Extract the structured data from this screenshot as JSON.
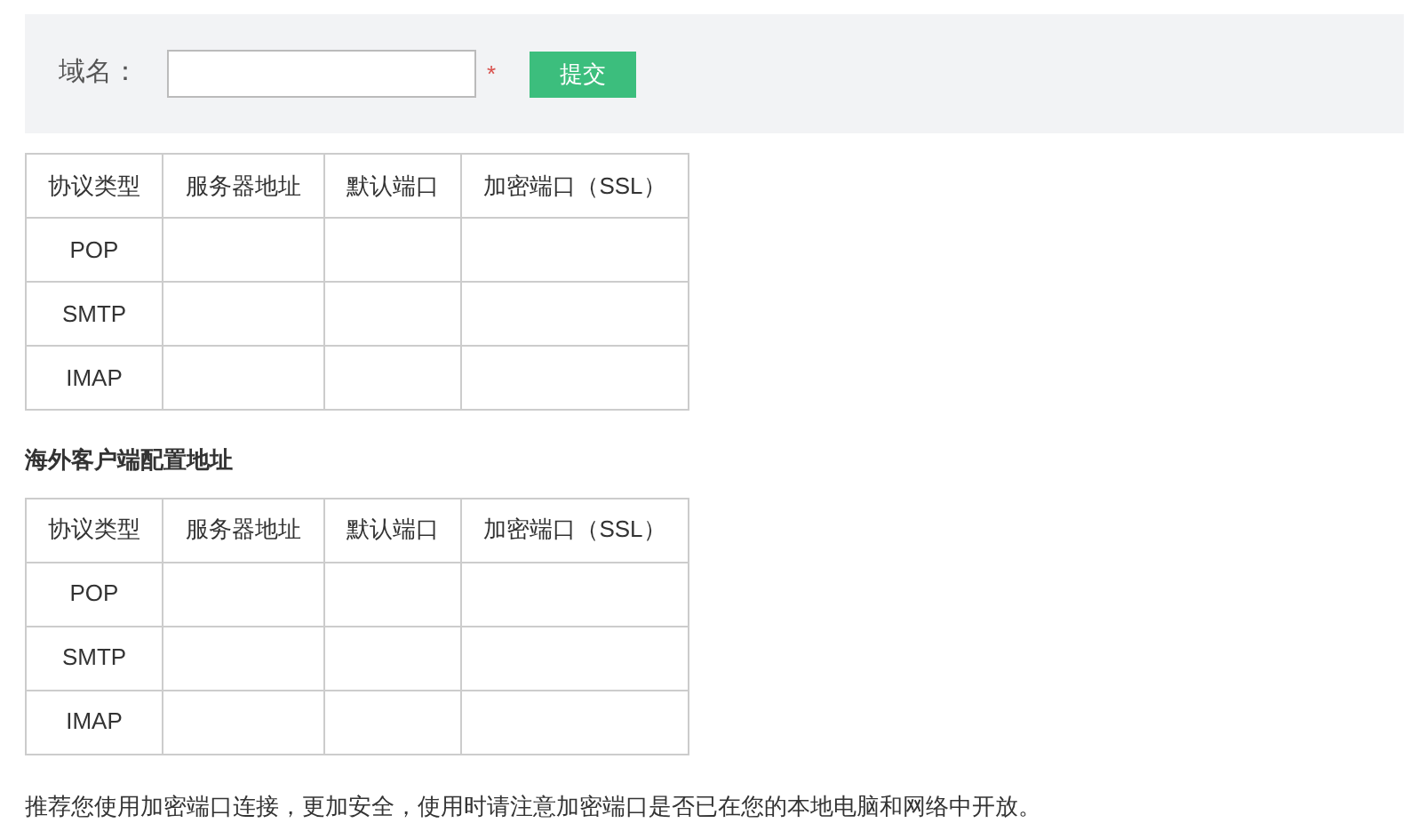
{
  "form": {
    "label": "域名：",
    "required_mark": "*",
    "submit": "提交"
  },
  "tables": [
    {
      "columns": [
        "协议类型",
        "服务器地址",
        "默认端口",
        "加密端口（SSL）"
      ],
      "rows": [
        "POP",
        "SMTP",
        "IMAP"
      ]
    },
    {
      "title": "海外客户端配置地址",
      "columns": [
        "协议类型",
        "服务器地址",
        "默认端口",
        "加密端口（SSL）"
      ],
      "rows": [
        "POP",
        "SMTP",
        "IMAP"
      ]
    }
  ],
  "note": "推荐您使用加密端口连接，更加安全，使用时请注意加密端口是否已在您的本地电脑和网络中开放。"
}
